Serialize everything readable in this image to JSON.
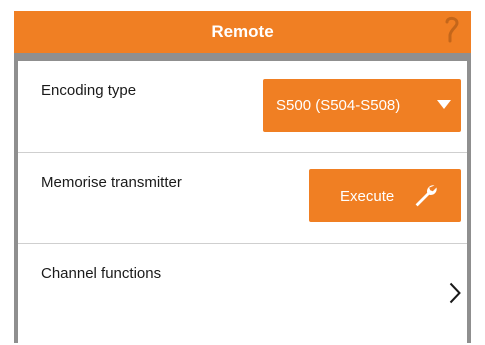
{
  "header": {
    "title": "Remote",
    "help_icon": "help-question-icon",
    "background_color": "#f07f23"
  },
  "settings": {
    "encoding": {
      "label": "Encoding type",
      "selected_value": "S500 (S504-S508)",
      "caret_icon": "caret-down-icon"
    },
    "memorise": {
      "label": "Memorise transmitter",
      "button_label": "Execute",
      "button_icon": "wrench-icon"
    },
    "channels": {
      "label": "Channel functions",
      "chevron_icon": "chevron-right-icon"
    }
  },
  "colors": {
    "accent": "#f07f23",
    "frame": "#8f8f8f",
    "divider": "#cfcfcf",
    "text": "#1a1a1a"
  }
}
